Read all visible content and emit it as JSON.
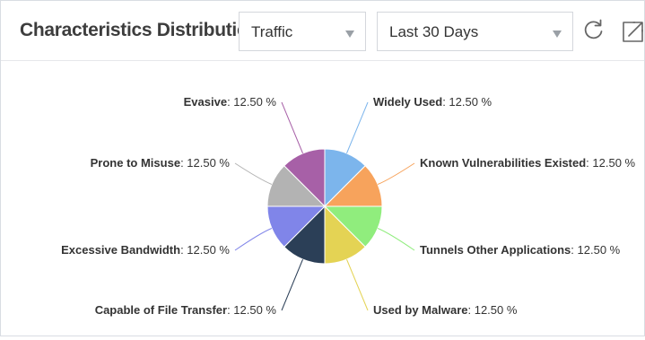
{
  "header": {
    "title": "Characteristics Distribution",
    "traffic_select": {
      "value": "Traffic"
    },
    "range_select": {
      "value": "Last 30 Days"
    },
    "refresh_icon": "refresh-icon",
    "expand_icon": "expand-icon"
  },
  "chart_data": {
    "type": "pie",
    "title": "",
    "unit": "%",
    "legend": "none",
    "slices": [
      {
        "name": "Widely Used",
        "value": 12.5,
        "display": "12.50 %",
        "color": "#7cb5ec"
      },
      {
        "name": "Known Vulnerabilities Existed",
        "value": 12.5,
        "display": "12.50 %",
        "color": "#f7a35c"
      },
      {
        "name": "Tunnels Other Applications",
        "value": 12.5,
        "display": "12.50 %",
        "color": "#90ed7d"
      },
      {
        "name": "Used by Malware",
        "value": 12.5,
        "display": "12.50 %",
        "color": "#e4d354"
      },
      {
        "name": "Capable of File Transfer",
        "value": 12.5,
        "display": "12.50 %",
        "color": "#2b3f57"
      },
      {
        "name": "Excessive Bandwidth",
        "value": 12.5,
        "display": "12.50 %",
        "color": "#8085e9"
      },
      {
        "name": "Prone to Misuse",
        "value": 12.5,
        "display": "12.50 %",
        "color": "#b3b3b3"
      },
      {
        "name": "Evasive",
        "value": 12.5,
        "display": "12.50 %",
        "color": "#a760a7"
      }
    ]
  }
}
